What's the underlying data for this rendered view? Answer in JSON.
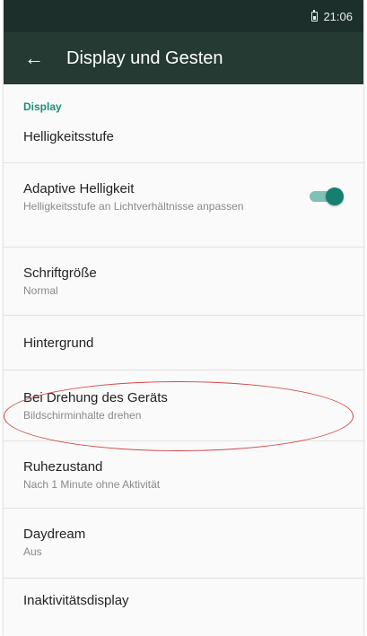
{
  "statusbar": {
    "time": "21:06",
    "battery_icon": "battery-icon"
  },
  "appbar": {
    "title": "Display und Gesten",
    "back_icon": "arrow-left-icon"
  },
  "section": {
    "label": "Display"
  },
  "items": [
    {
      "title": "Helligkeitsstufe",
      "subtitle": ""
    },
    {
      "title": "Adaptive Helligkeit",
      "subtitle": "Helligkeitsstufe an Lichtverhältnisse anpassen",
      "toggle_on": true
    },
    {
      "title": "Schriftgröße",
      "subtitle": "Normal"
    },
    {
      "title": "Hintergrund",
      "subtitle": ""
    },
    {
      "title": "Bei Drehung des Geräts",
      "subtitle": "Bildschirminhalte drehen"
    },
    {
      "title": "Ruhezustand",
      "subtitle": "Nach 1 Minute ohne Aktivität"
    },
    {
      "title": "Daydream",
      "subtitle": "Aus"
    },
    {
      "title": "Inaktivitätsdisplay",
      "subtitle": ""
    }
  ],
  "colors": {
    "accent": "#16806e",
    "appbar": "#243a33",
    "statusbar": "#1d2f2a",
    "highlight": "#d24646"
  }
}
